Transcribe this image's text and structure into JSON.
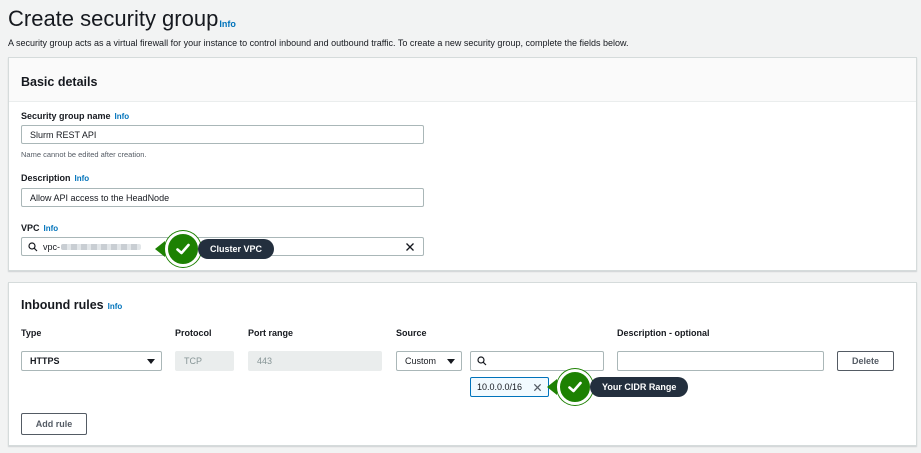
{
  "page": {
    "title": "Create security group",
    "title_info": "Info",
    "description": "A security group acts as a virtual firewall for your instance to control inbound and outbound traffic. To create a new security group, complete the fields below."
  },
  "basic_details": {
    "heading": "Basic details",
    "name_label": "Security group name",
    "name_info": "Info",
    "name_value": "Slurm REST API",
    "name_hint": "Name cannot be edited after creation.",
    "desc_label": "Description",
    "desc_info": "Info",
    "desc_value": "Allow API access to the HeadNode",
    "vpc_label": "VPC",
    "vpc_info": "Info",
    "vpc_value": "vpc-",
    "vpc_callout": "Cluster VPC"
  },
  "inbound": {
    "heading": "Inbound rules",
    "info": "Info",
    "columns": [
      "Type",
      "Protocol",
      "Port range",
      "Source",
      "Description - optional"
    ],
    "row": {
      "type": "HTTPS",
      "protocol": "TCP",
      "port": "443",
      "source_type": "Custom",
      "search_value": "",
      "cidr_tag": "10.0.0.0/16",
      "description_value": "",
      "delete_label": "Delete"
    },
    "cidr_callout": "Your CIDR Range",
    "add_rule_label": "Add rule"
  },
  "colors": {
    "link": "#0073bb",
    "callout_green": "#1d8102",
    "callout_dark": "#232f3e"
  },
  "icons": [
    "search-icon",
    "clear-icon",
    "caret-down-icon",
    "check-circle-icon",
    "remove-icon"
  ]
}
